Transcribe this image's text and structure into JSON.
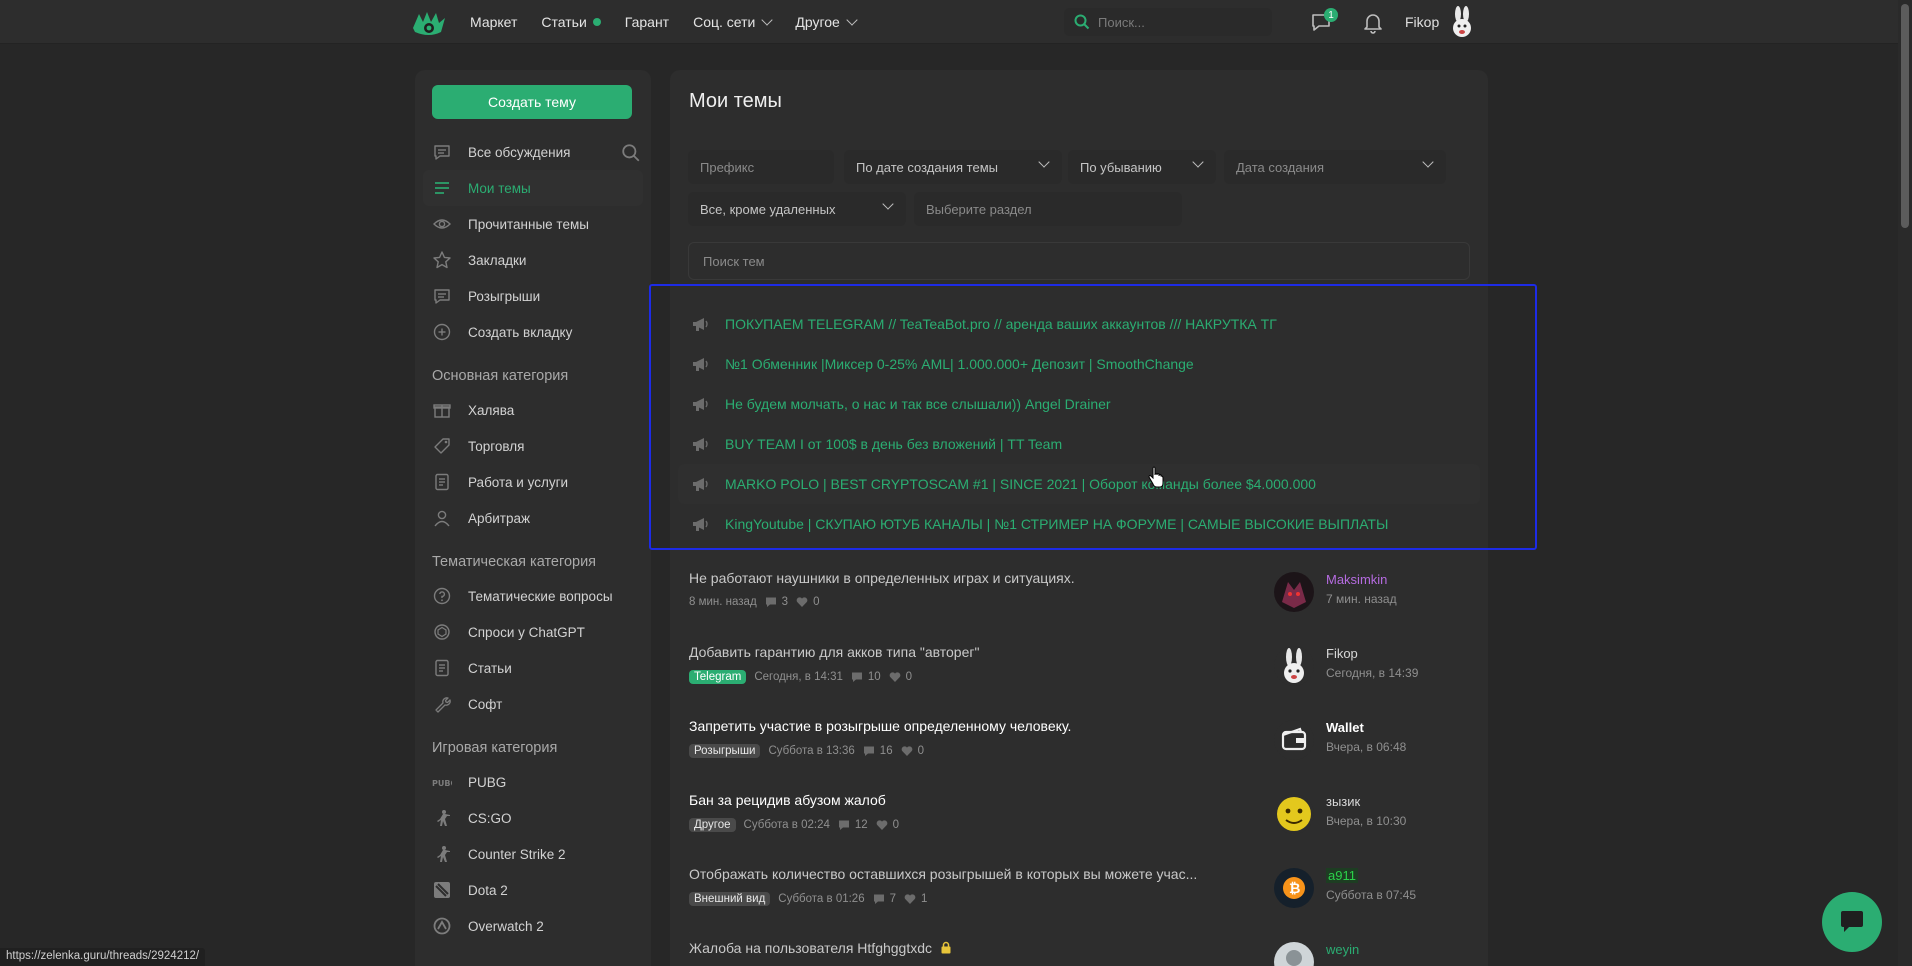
{
  "colors": {
    "accent": "#2bad72",
    "bg": "#272727",
    "panel": "#2d2d2d",
    "highlight": "#1d2be6"
  },
  "topbar": {
    "nav": [
      {
        "label": "Маркет"
      },
      {
        "label": "Статьи"
      },
      {
        "label": "Гарант"
      },
      {
        "label": "Соц. сети"
      },
      {
        "label": "Другое"
      }
    ],
    "search_placeholder": "Поиск...",
    "messages_badge": "1",
    "username": "Fikop"
  },
  "sidebar": {
    "create_button": "Создать тему",
    "items": [
      {
        "label": "Все обсуждения",
        "icon": "chat-icon"
      },
      {
        "label": "Мои темы",
        "icon": "list-icon"
      },
      {
        "label": "Прочитанные темы",
        "icon": "eye-icon"
      },
      {
        "label": "Закладки",
        "icon": "star-icon"
      },
      {
        "label": "Розыгрыши",
        "icon": "chat-icon"
      },
      {
        "label": "Создать вкладку",
        "icon": "plus-icon"
      }
    ],
    "sections": [
      {
        "title": "Основная категория",
        "items": [
          {
            "label": "Халява",
            "icon": "gift-icon"
          },
          {
            "label": "Торговля",
            "icon": "tag-icon"
          },
          {
            "label": "Работа и услуги",
            "icon": "document-icon"
          },
          {
            "label": "Арбитраж",
            "icon": "user-icon"
          }
        ]
      },
      {
        "title": "Тематическая категория",
        "items": [
          {
            "label": "Тематические вопросы",
            "icon": "question-icon"
          },
          {
            "label": "Спроси у ChatGPT",
            "icon": "chatgpt-icon"
          },
          {
            "label": "Статьи",
            "icon": "document-icon"
          },
          {
            "label": "Софт",
            "icon": "wrench-icon"
          }
        ]
      },
      {
        "title": "Игровая категория",
        "items": [
          {
            "label": "PUBG",
            "icon": "pubg-icon"
          },
          {
            "label": "CS:GO",
            "icon": "soldier-icon"
          },
          {
            "label": "Counter Strike 2",
            "icon": "soldier-icon"
          },
          {
            "label": "Dota 2",
            "icon": "dota-icon"
          },
          {
            "label": "Overwatch 2",
            "icon": "overwatch-icon"
          }
        ]
      }
    ]
  },
  "main": {
    "title": "Мои темы",
    "filters": {
      "prefix": "Префикс",
      "sort": "По дате создания темы",
      "order": "По убыванию",
      "date": "Дата создания",
      "state": "Все, кроме удаленных",
      "section": "Выберите раздел"
    },
    "search_placeholder": "Поиск тем",
    "sticky_threads": [
      "ПОКУПАЕМ TELEGRAM // TeaTeaBot.pro // аренда ваших аккаунтов /// НАКРУТКА ТГ",
      "№1 Обменник |Миксер 0-25% AML| 1.000.000+ Депозит | SmoothChange",
      "Не будем молчать, о нас и так все слышали)) Angel Drainer",
      "BUY TEAM I от 100$ в день без вложений | TT Team",
      "MARKO POLO | BEST CRYPTOSCAM #1 | SINCE 2021 | Оборот команды более $4.000.000",
      "KingYoutube | СКУПАЮ ЮТУБ КАНАЛЫ | №1 СТРИМЕР НА ФОРУМЕ | САМЫЕ ВЫСОКИЕ ВЫПЛАТЫ"
    ],
    "threads": [
      {
        "title": "Не работают наушники в определенных играх и ситуациях.",
        "tag": "",
        "time": "8 мин. назад",
        "replies": "3",
        "likes": "0",
        "user": "Maksimkin",
        "user_color": "#b56be0",
        "last_time": "7 мин. назад",
        "strong": false
      },
      {
        "title": "Добавить гарантию для акков типа \"авторег\"",
        "tag": "Telegram",
        "tag_green": true,
        "time": "Сегодня, в 14:31",
        "replies": "10",
        "likes": "0",
        "user": "Fikop",
        "user_color": "#d8d8d8",
        "last_time": "Сегодня, в 14:39",
        "strong": false
      },
      {
        "title": "Запретить участие в розыгрыше определенному человеку.",
        "tag": "Розыгрыши",
        "time": "Суббота в 13:36",
        "replies": "16",
        "likes": "0",
        "user": "Wallet",
        "user_color": "#ffffff",
        "last_time": "Вчера, в 06:48",
        "strong": true
      },
      {
        "title": "Бан за рецидив абузом жалоб",
        "tag": "Другое",
        "time": "Суббота в 02:24",
        "replies": "12",
        "likes": "0",
        "user": "зызик",
        "user_color": "#d8d8d8",
        "last_time": "Вчера, в 10:30",
        "strong": true
      },
      {
        "title": "Отображать количество оставшихся розыгрышей в которых вы можете учас...",
        "tag": "Внешний вид",
        "time": "Суббота в 01:26",
        "replies": "7",
        "likes": "1",
        "user": "a911",
        "user_color": "#2bd14a",
        "last_time": "Суббота в 07:45",
        "strong": false
      },
      {
        "title": "Жалоба на пользователя Htfghggtxdc",
        "tag": "",
        "time": "",
        "replies": "",
        "likes": "",
        "user": "weyin",
        "user_color": "#2bad72",
        "last_time": "",
        "strong": false,
        "locked": true
      }
    ]
  },
  "status_url": "https://zelenka.guru/threads/2924212/"
}
